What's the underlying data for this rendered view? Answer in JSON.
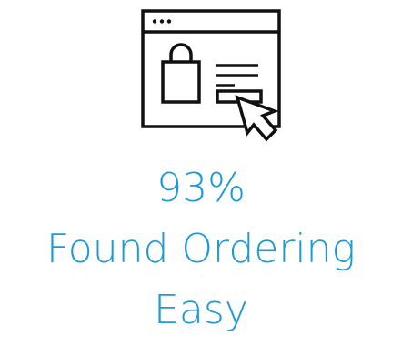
{
  "icon": "online-shopping-browser-icon",
  "accent_color": "#1b9ad6",
  "stat": {
    "percent": "93%",
    "label_line1": "Found Ordering",
    "label_line2": "Easy"
  }
}
